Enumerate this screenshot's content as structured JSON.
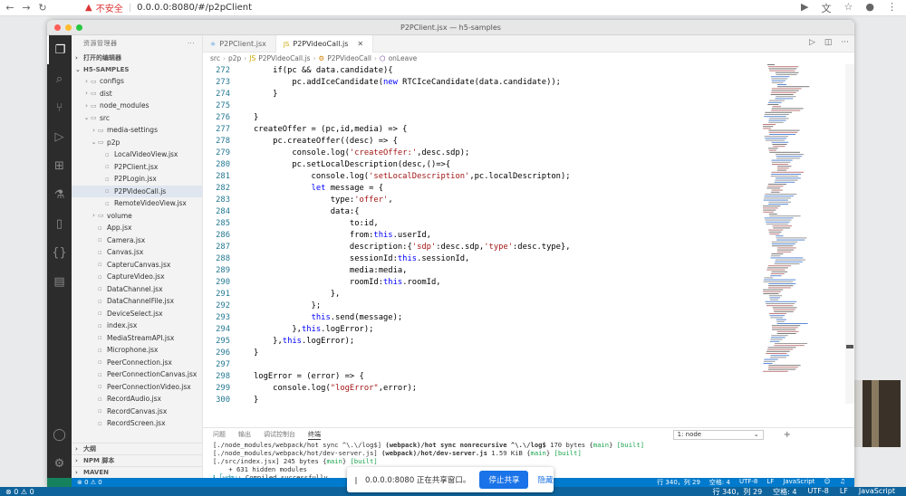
{
  "browser": {
    "back": "←",
    "forward": "→",
    "reload": "↻",
    "warning": "▲",
    "insecure_label": "不安全",
    "url": "0.0.0.0:8080/#/p2pClient",
    "icons": [
      "video-icon",
      "translate-icon",
      "star-icon",
      "account-icon",
      "menu-icon"
    ]
  },
  "window": {
    "title": "P2PClient.jsx — h5-samples"
  },
  "sidebar": {
    "header": "资源管理器",
    "more": "···",
    "open_editors": "打开的编辑器",
    "project": "H5-SAMPLES",
    "tree": [
      {
        "depth": 1,
        "type": "folder",
        "open": false,
        "label": "configs"
      },
      {
        "depth": 1,
        "type": "folder",
        "open": false,
        "label": "dist"
      },
      {
        "depth": 1,
        "type": "folder",
        "open": false,
        "label": "node_modules"
      },
      {
        "depth": 1,
        "type": "folder",
        "open": true,
        "label": "src"
      },
      {
        "depth": 2,
        "type": "folder",
        "open": false,
        "label": "media-settings"
      },
      {
        "depth": 2,
        "type": "folder",
        "open": true,
        "label": "p2p"
      },
      {
        "depth": 3,
        "type": "file",
        "label": "LocalVideoView.jsx"
      },
      {
        "depth": 3,
        "type": "file",
        "label": "P2PClient.jsx"
      },
      {
        "depth": 3,
        "type": "file",
        "label": "P2PLogin.jsx"
      },
      {
        "depth": 3,
        "type": "file",
        "label": "P2PVideoCall.js",
        "selected": true
      },
      {
        "depth": 3,
        "type": "file",
        "label": "RemoteVideoView.jsx"
      },
      {
        "depth": 2,
        "type": "folder",
        "open": false,
        "label": "volume"
      },
      {
        "depth": 2,
        "type": "file",
        "label": "App.jsx"
      },
      {
        "depth": 2,
        "type": "file",
        "label": "Camera.jsx"
      },
      {
        "depth": 2,
        "type": "file",
        "label": "Canvas.jsx"
      },
      {
        "depth": 2,
        "type": "file",
        "label": "CapteruCanvas.jsx"
      },
      {
        "depth": 2,
        "type": "file",
        "label": "CaptureVideo.jsx"
      },
      {
        "depth": 2,
        "type": "file",
        "label": "DataChannel.jsx"
      },
      {
        "depth": 2,
        "type": "file",
        "label": "DataChannelFile.jsx"
      },
      {
        "depth": 2,
        "type": "file",
        "label": "DeviceSelect.jsx"
      },
      {
        "depth": 2,
        "type": "file",
        "label": "index.jsx"
      },
      {
        "depth": 2,
        "type": "file",
        "label": "MediaStreamAPI.jsx"
      },
      {
        "depth": 2,
        "type": "file",
        "label": "Microphone.jsx"
      },
      {
        "depth": 2,
        "type": "file",
        "label": "PeerConnection.jsx"
      },
      {
        "depth": 2,
        "type": "file",
        "label": "PeerConnectionCanvas.jsx"
      },
      {
        "depth": 2,
        "type": "file",
        "label": "PeerConnectionVideo.jsx"
      },
      {
        "depth": 2,
        "type": "file",
        "label": "RecordAudio.jsx"
      },
      {
        "depth": 2,
        "type": "file",
        "label": "RecordCanvas.jsx"
      },
      {
        "depth": 2,
        "type": "file",
        "label": "RecordScreen.jsx"
      }
    ],
    "outline": "大纲",
    "npm": "NPM 脚本",
    "maven": "MAVEN"
  },
  "tabs": [
    {
      "label": "P2PClient.jsx",
      "active": false
    },
    {
      "label": "P2PVideoCall.js",
      "active": true
    }
  ],
  "breadcrumb": [
    "src",
    "p2p",
    "P2PVideoCall.js",
    "P2PVideoCall",
    "onLeave"
  ],
  "code": [
    {
      "n": "272",
      "t": [
        [
          "tx",
          "    if(pc && data.candidate){"
        ]
      ]
    },
    {
      "n": "273",
      "t": [
        [
          "tx",
          "        pc.addIceCandidate("
        ],
        [
          "kw",
          "new"
        ],
        [
          "tx",
          " RTCIceCandidate(data.candidate));"
        ]
      ]
    },
    {
      "n": "274",
      "t": [
        [
          "tx",
          "    }"
        ]
      ]
    },
    {
      "n": "275",
      "t": [
        [
          "tx",
          ""
        ]
      ]
    },
    {
      "n": "276",
      "t": [
        [
          "tx",
          "}"
        ]
      ]
    },
    {
      "n": "277",
      "t": [
        [
          "tx",
          "createOffer = (pc,id,media) => {"
        ]
      ]
    },
    {
      "n": "278",
      "t": [
        [
          "tx",
          "    pc.createOffer((desc) => {"
        ]
      ]
    },
    {
      "n": "279",
      "t": [
        [
          "tx",
          "        console.log("
        ],
        [
          "st",
          "'createOffer:'"
        ],
        [
          "tx",
          ",desc.sdp);"
        ]
      ]
    },
    {
      "n": "280",
      "t": [
        [
          "tx",
          "        pc.setLocalDescription(desc,()=>{"
        ]
      ]
    },
    {
      "n": "281",
      "t": [
        [
          "tx",
          "            console.log("
        ],
        [
          "st",
          "'setLocalDescription'"
        ],
        [
          "tx",
          ",pc.localDescripton);"
        ]
      ]
    },
    {
      "n": "282",
      "t": [
        [
          "tx",
          "            "
        ],
        [
          "kw",
          "let"
        ],
        [
          "tx",
          " message = {"
        ]
      ]
    },
    {
      "n": "283",
      "t": [
        [
          "tx",
          "                type:"
        ],
        [
          "st",
          "'offer'"
        ],
        [
          "tx",
          ","
        ]
      ]
    },
    {
      "n": "284",
      "t": [
        [
          "tx",
          "                data:{"
        ]
      ]
    },
    {
      "n": "285",
      "t": [
        [
          "tx",
          "                    to:id,"
        ]
      ]
    },
    {
      "n": "286",
      "t": [
        [
          "tx",
          "                    from:"
        ],
        [
          "kw",
          "this"
        ],
        [
          "tx",
          ".userId,"
        ]
      ]
    },
    {
      "n": "287",
      "t": [
        [
          "tx",
          "                    description:{"
        ],
        [
          "st",
          "'sdp'"
        ],
        [
          "tx",
          ":desc.sdp,"
        ],
        [
          "st",
          "'type'"
        ],
        [
          "tx",
          ":desc.type},"
        ]
      ]
    },
    {
      "n": "288",
      "t": [
        [
          "tx",
          "                    sessionId:"
        ],
        [
          "kw",
          "this"
        ],
        [
          "tx",
          ".sessionId,"
        ]
      ]
    },
    {
      "n": "289",
      "t": [
        [
          "tx",
          "                    media:media,"
        ]
      ]
    },
    {
      "n": "290",
      "t": [
        [
          "tx",
          "                    roomId:"
        ],
        [
          "kw",
          "this"
        ],
        [
          "tx",
          ".roomId,"
        ]
      ]
    },
    {
      "n": "291",
      "t": [
        [
          "tx",
          "                },"
        ]
      ]
    },
    {
      "n": "292",
      "t": [
        [
          "tx",
          "            };"
        ]
      ]
    },
    {
      "n": "293",
      "t": [
        [
          "tx",
          "            "
        ],
        [
          "kw",
          "this"
        ],
        [
          "tx",
          ".send(message);"
        ]
      ]
    },
    {
      "n": "294",
      "t": [
        [
          "tx",
          "        },"
        ],
        [
          "kw",
          "this"
        ],
        [
          "tx",
          ".logError);"
        ]
      ]
    },
    {
      "n": "295",
      "t": [
        [
          "tx",
          "    },"
        ],
        [
          "kw",
          "this"
        ],
        [
          "tx",
          ".logError);"
        ]
      ]
    },
    {
      "n": "296",
      "t": [
        [
          "tx",
          "}"
        ]
      ]
    },
    {
      "n": "297",
      "t": [
        [
          "tx",
          ""
        ]
      ]
    },
    {
      "n": "298",
      "t": [
        [
          "tx",
          "logError = (error) => {"
        ]
      ]
    },
    {
      "n": "299",
      "t": [
        [
          "tx",
          "    console.log("
        ],
        [
          "st",
          "\"logError\""
        ],
        [
          "tx",
          ",error);"
        ]
      ]
    },
    {
      "n": "300",
      "t": [
        [
          "tx",
          "}"
        ]
      ]
    }
  ],
  "panel": {
    "tabs": [
      "问题",
      "输出",
      "调试控制台",
      "终端"
    ],
    "active_tab": "终端",
    "terminal_select": "1: node",
    "add": "+",
    "lines": [
      [
        [
          "",
          "[./node_modules/webpack/hot sync ^\\.\\/log$] "
        ],
        [
          "b",
          "(webpack)/hot sync nonrecursive ^\\.\\/log$"
        ],
        [
          "",
          " 170 bytes {"
        ],
        [
          "g",
          "main"
        ],
        [
          "",
          "} "
        ],
        [
          "g",
          "[built]"
        ]
      ],
      [
        [
          "",
          "[./node_modules/webpack/hot/dev-server.js] "
        ],
        [
          "b",
          "(webpack)/hot/dev-server.js"
        ],
        [
          "",
          " 1.59 KiB {"
        ],
        [
          "g",
          "main"
        ],
        [
          "",
          "} "
        ],
        [
          "g",
          "[built]"
        ]
      ],
      [
        [
          "",
          "[./src/index.jsx] 245 bytes {"
        ],
        [
          "g",
          "main"
        ],
        [
          "",
          "} "
        ],
        [
          "g",
          "[built]"
        ]
      ],
      [
        [
          "",
          "    + 631 hidden modules"
        ]
      ],
      [
        [
          "c",
          "ℹ ｢wdm｣"
        ],
        [
          "",
          ": Compiled successfully."
        ]
      ],
      [
        [
          "",
          "▯"
        ]
      ]
    ]
  },
  "status": {
    "errors": "⊗ 0 ⚠ 0",
    "cursor": "行 340，列 29",
    "spaces": "空格: 4",
    "encoding": "UTF-8",
    "eol": "LF",
    "language": "JavaScript"
  },
  "share_bar": {
    "message": "0.0.0.0:8080 正在共享窗口。",
    "stop_label": "停止共享",
    "hide_label": "隐藏"
  },
  "colors": {
    "status_bg": "#007acc",
    "activity_bg": "#2c2c2c",
    "stop_button": "#1a73e8"
  }
}
